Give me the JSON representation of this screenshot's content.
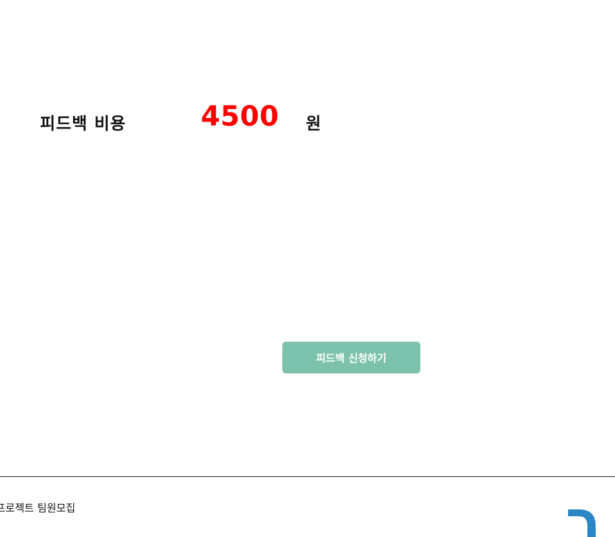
{
  "feedback": {
    "cost_label": "피드백 비용",
    "cost_amount": "4500",
    "cost_unit": "원",
    "apply_button_label": "피드백 신청하기"
  },
  "footer": {
    "project_text": "프로젝트 팀원모집"
  },
  "icons": {
    "footer_logo": "brand-logo-icon"
  },
  "colors": {
    "cost_amount": "#ff0000",
    "apply_button_bg": "#7dc2ad",
    "logo": "#2a86c5"
  }
}
